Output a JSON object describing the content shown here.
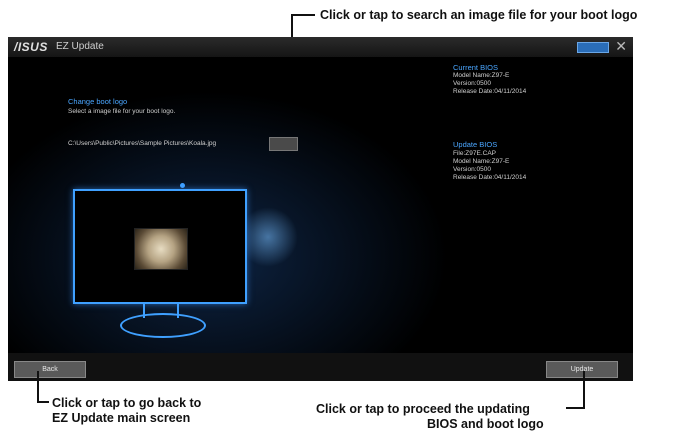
{
  "callouts": {
    "browse": "Click or tap to search an image file for your boot logo",
    "back_line1": "Click or tap to go back to",
    "back_line2": "EZ Update main screen",
    "update_line1": "Click or tap to proceed the updating",
    "update_line2": "BIOS and boot logo"
  },
  "app": {
    "logo": "/ISUS",
    "title": "EZ Update",
    "close_glyph": "✕"
  },
  "boot_logo": {
    "heading": "Change boot logo",
    "instruction": "Select a image file for your boot logo.",
    "file_path": "C:\\Users\\Public\\Pictures\\Sample Pictures\\Koala.jpg"
  },
  "current_bios": {
    "heading": "Current BIOS",
    "model": "Model Name:Z97-E",
    "version": "Version:0500",
    "release": "Release Date:04/11/2014"
  },
  "update_bios": {
    "heading": "Update BIOS",
    "file": "File:Z97E.CAP",
    "model": "Model Name:Z97-E",
    "version": "Version:0500",
    "release": "Release Date:04/11/2014"
  },
  "buttons": {
    "back": "Back",
    "update": "Update"
  },
  "colors": {
    "accent": "#3fa0ff",
    "background": "#000000"
  }
}
